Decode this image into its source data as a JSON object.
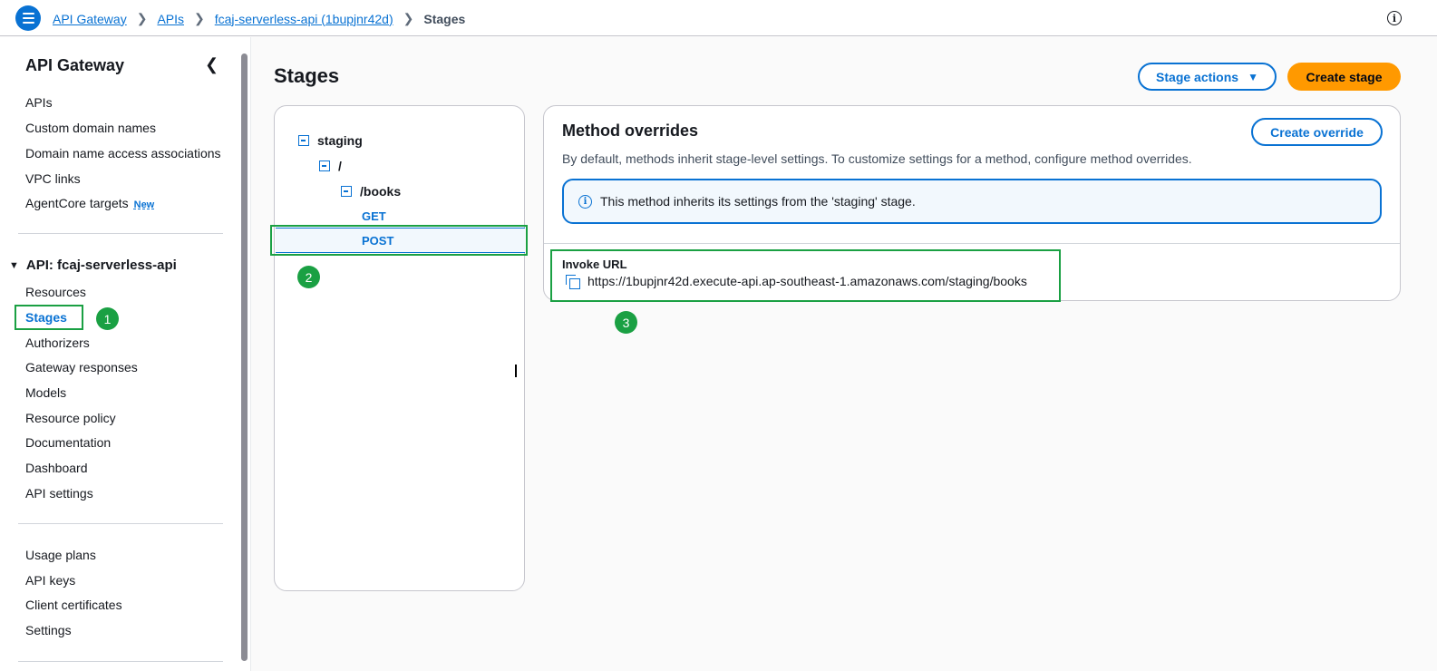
{
  "breadcrumb": {
    "items": [
      "API Gateway",
      "APIs",
      "fcaj-serverless-api (1bupjnr42d)"
    ],
    "current": "Stages"
  },
  "sidebar": {
    "title": "API Gateway",
    "top_items": [
      "APIs",
      "Custom domain names",
      "Domain name access associations",
      "VPC links",
      "AgentCore targets"
    ],
    "new_badge": "New",
    "api_section": "API: fcaj-serverless-api",
    "api_items": [
      "Resources",
      "Stages",
      "Authorizers",
      "Gateway responses",
      "Models",
      "Resource policy",
      "Documentation",
      "Dashboard",
      "API settings"
    ],
    "bottom_items": [
      "Usage plans",
      "API keys",
      "Client certificates",
      "Settings"
    ]
  },
  "main": {
    "title": "Stages",
    "stage_actions_label": "Stage actions",
    "create_stage_label": "Create stage"
  },
  "tree": {
    "stage": "staging",
    "root": "/",
    "resource": "/books",
    "methods": [
      "GET",
      "POST"
    ]
  },
  "overrides": {
    "title": "Method overrides",
    "create_label": "Create override",
    "description": "By default, methods inherit stage-level settings. To customize settings for a method, configure method overrides.",
    "alert": "This method inherits its settings from the 'staging' stage.",
    "invoke_label": "Invoke URL",
    "invoke_url": "https://1bupjnr42d.execute-api.ap-southeast-1.amazonaws.com/staging/books"
  },
  "annotations": [
    "1",
    "2",
    "3"
  ],
  "colors": {
    "accent": "#0972d3",
    "primary_button": "#ff9900",
    "highlight": "#1aa043"
  }
}
